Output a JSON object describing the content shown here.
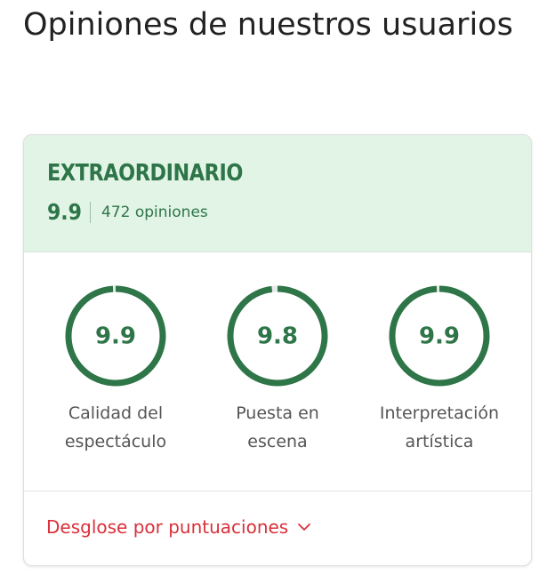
{
  "page": {
    "title": "Opiniones de nuestros usuarios"
  },
  "summary": {
    "rating_word": "EXTRAORDINARIO",
    "overall_score": "9.9",
    "review_count": "472 opiniones"
  },
  "metrics": [
    {
      "value": "9.9",
      "score": 9.9,
      "label_line1": "Calidad del",
      "label_line2": "espectáculo"
    },
    {
      "value": "9.8",
      "score": 9.8,
      "label_line1": "Puesta en",
      "label_line2": "escena"
    },
    {
      "value": "9.9",
      "score": 9.9,
      "label_line1": "Interpretación",
      "label_line2": "artística"
    }
  ],
  "footer": {
    "breakdown_label": "Desglose por puntuaciones",
    "chevron_icon": "chevron-down-icon"
  },
  "colors": {
    "accent_green": "#2e7548",
    "header_background": "#e1f4e6",
    "link_red": "#d9303a",
    "ring_track": "#e9e9e9"
  }
}
